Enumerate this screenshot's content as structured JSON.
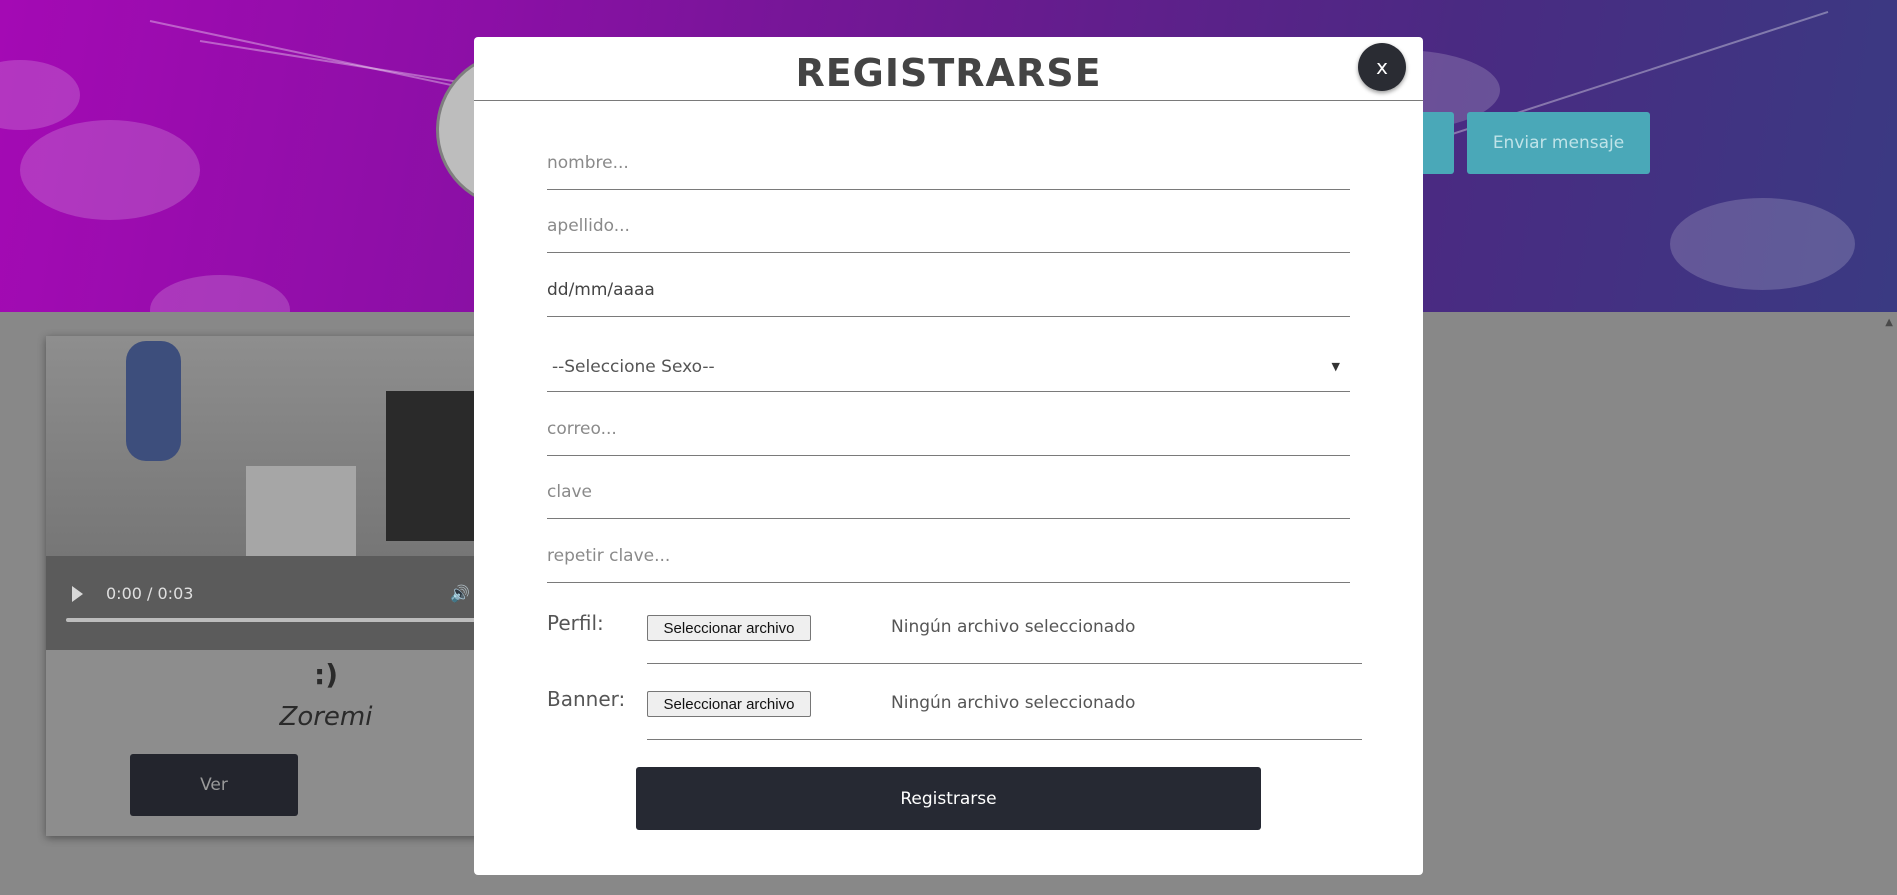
{
  "background": {
    "contact_button": "Enviar mensaje",
    "video": {
      "time": "0:00 / 0:03"
    },
    "card": {
      "title": ":)",
      "author": "Zoremi",
      "view_button": "Ver"
    }
  },
  "modal": {
    "title": "REGISTRARSE",
    "close_label": "x",
    "fields": {
      "nombre": "nombre...",
      "apellido": "apellido...",
      "fecha": "dd/mm/aaaa",
      "sexo": "--Seleccione Sexo--",
      "correo": "correo...",
      "clave": "clave",
      "repetir_clave": "repetir clave..."
    },
    "perfil": {
      "label": "Perfil:",
      "button": "Seleccionar archivo",
      "status": "Ningún archivo seleccionado"
    },
    "banner": {
      "label": "Banner:",
      "button": "Seleccionar archivo",
      "status": "Ningún archivo seleccionado"
    },
    "submit": "Registrarse"
  },
  "colors": {
    "modal_bg": "#ffffff",
    "dark_button": "#262933",
    "accent_teal": "#4aa8b8",
    "banner_purple": "#a40ab4"
  }
}
